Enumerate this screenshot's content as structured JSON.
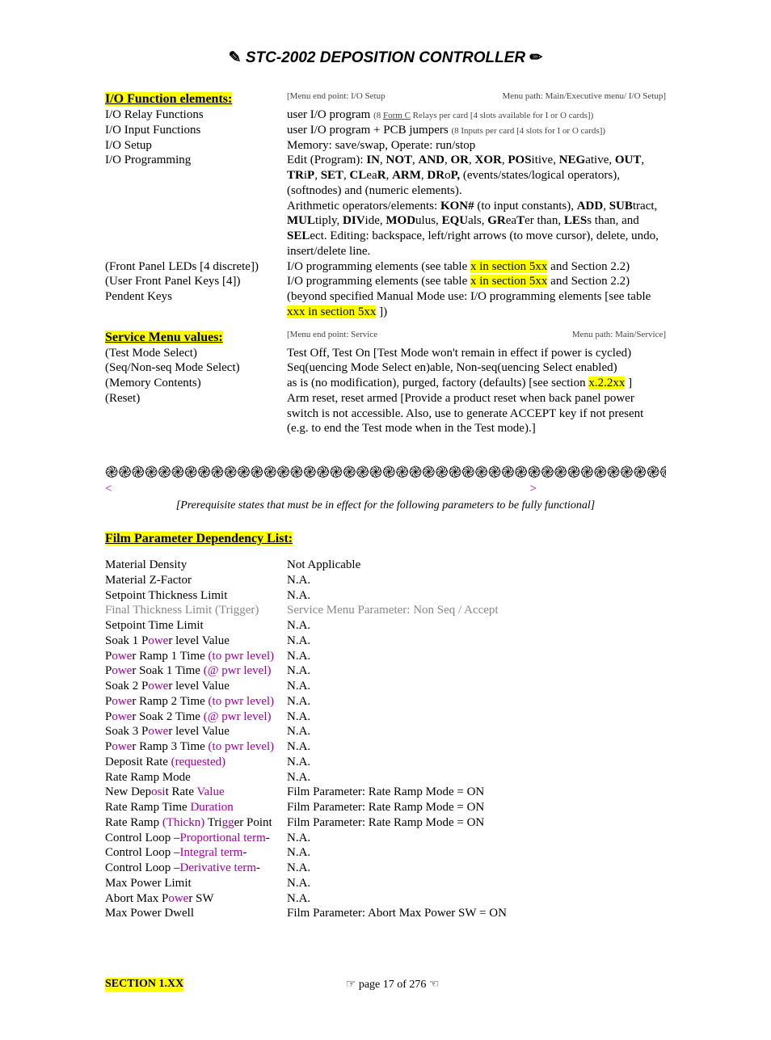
{
  "header": {
    "title": "STC-2002  DEPOSITION CONTROLLER"
  },
  "io_section": {
    "heading": "I/O Function elements:",
    "menu_end": "[Menu end point: I/O Setup",
    "menu_path": "Menu path: Main/Executive menu/ I/O Setup]",
    "rows": {
      "relay_l": "I/O Relay Functions",
      "relay_r_a": "user I/O program ",
      "relay_r_b": "(8 ",
      "relay_r_c": "Form C",
      "relay_r_d": " Relays per card [4 slots available for I or O cards])",
      "input_l": "I/O Input Functions",
      "input_r_a": "user I/O program + PCB jumpers ",
      "input_r_b": "(8 Inputs per card [4 slots for I or O cards])",
      "setup_l": "I/O Setup",
      "setup_r": "Memory: save/swap, Operate: run/stop",
      "prog_l": "I/O Programming",
      "prog_r1": "Edit (Program): IN, NOT, AND, OR, XOR, POSitive, NEGative, OUT, TRiP, SET, CLeaR, ARM, DRoP, (events/states/logical operators), (softnodes) and (numeric elements).",
      "prog_r2": "Arithmetic operators/elements: KON# (to input constants), ADD, SUBtract, MULtiply, DIVide, MODulus, EQUals, GReaTer than, LESs than, and SELect. Editing: backspace, left/right arrows (to move cursor), delete, undo, insert/delete line.",
      "fp_l": "(Front Panel LEDs [4 discrete])",
      "fp_r_a": "I/O programming elements (see table ",
      "fp_hl": "x in section 5xx",
      "fp_r_b": " and Section 2.2)",
      "uk_l": "(User Front Panel Keys [4])",
      "pk_l": "Pendent Keys",
      "pk_r_a": "(beyond specified Manual Mode use: I/O programming elements  [see table ",
      "pk_hl": "xxx in section 5xx",
      "pk_r_b": " ])"
    }
  },
  "service_section": {
    "heading": "Service Menu values:",
    "menu_end": "[Menu end point: Service",
    "menu_path": "Menu path: Main/Service]",
    "rows": {
      "test_l": "(Test Mode Select)",
      "test_r": "Test Off, Test On [Test Mode won't remain in effect if power is cycled)",
      "seq_l": "(Seq/Non-seq Mode Select)",
      "seq_r": "Seq(uencing Mode Select en)able, Non-seq(uencing Select enabled)",
      "mem_l": "(Memory Contents)",
      "mem_r_a": "as is (no modification), purged, factory (defaults) [see section ",
      "mem_hl": "x.2.2xx",
      "mem_r_b": " ]",
      "rst_l": "(Reset)",
      "rst_r": "Arm reset, reset armed [Provide a product reset when back panel power switch is not accessible.  Also, use to generate ACCEPT key if not present (e.g. to end the Test mode when in the Test mode).]"
    }
  },
  "divider": {
    "squiggle": "ֽ֎֎֎֎֎֎֎֎֎֎֎֎֎֎֎֎֎֎֎֎֎֎֎֎֎֎֎֎֎֎֎֎֎֎֎֎֎֎֎֎֎֎֎֎ֽ",
    "lt": "<",
    "gt": ">",
    "prereq": "[Prerequisite states that must be in effect for the following parameters to be fully functional]"
  },
  "film_section": {
    "heading": "Film Parameter Dependency List:",
    "rows": [
      {
        "l": "Material Density",
        "r": "Not Applicable"
      },
      {
        "l": "Material Z-Factor",
        "r": "N.A."
      },
      {
        "l": "Setpoint Thickness Limit",
        "r": "N.A."
      },
      {
        "l": "Final Thickness Limit (Trigger)",
        "r": "Service Menu Parameter: Non Seq / Accept",
        "gray": true
      },
      {
        "l": "Setpoint Time Limit",
        "r": "N.A."
      },
      {
        "l": "Soak 1 Power level Value",
        "r": "N.A."
      },
      {
        "l": "Power Ramp 1 Time (to pwr level)",
        "r": "N.A.",
        "p": true
      },
      {
        "l": "Power Soak 1 Time (@ pwr level)",
        "r": "N.A.",
        "p": true
      },
      {
        "l": "Soak 2 Power level Value",
        "r": "N.A."
      },
      {
        "l": "Power Ramp 2 Time (to pwr level)",
        "r": "N.A.",
        "p": true
      },
      {
        "l": "Power Soak 2 Time (@ pwr level)",
        "r": "N.A.",
        "p": true
      },
      {
        "l": "Soak 3 Power level Value",
        "r": "N.A."
      },
      {
        "l": "Power Ramp 3 Time (to pwr level)",
        "r": "N.A.",
        "p": true
      },
      {
        "l": "Deposit Rate (requested)",
        "r": "N.A."
      },
      {
        "l": "Rate Ramp Mode",
        "r": "N.A."
      },
      {
        "l": "New Deposit Rate Value",
        "r": "Film Parameter: Rate Ramp Mode = ON"
      },
      {
        "l": "Rate Ramp Time Duration",
        "r": "Film Parameter: Rate Ramp Mode = ON"
      },
      {
        "l": "Rate Ramp (Thickn) Trigger Point",
        "r": "Film Parameter: Rate Ramp Mode = ON"
      },
      {
        "l": "Control Loop –Proportional term-",
        "r": "N.A."
      },
      {
        "l": "Control Loop –Integral term-",
        "r": "N.A."
      },
      {
        "l": "Control Loop –Derivative term-",
        "r": "N.A."
      },
      {
        "l": "Max Power Limit",
        "r": "N.A."
      },
      {
        "l": "Abort Max Power SW",
        "r": "N.A."
      },
      {
        "l": "Max Power Dwell",
        "r": "Film Parameter: Abort Max Power SW = ON"
      }
    ]
  },
  "footer": {
    "section": "SECTION 1.XX",
    "page": "☞  page 17 of 276  ☜"
  }
}
